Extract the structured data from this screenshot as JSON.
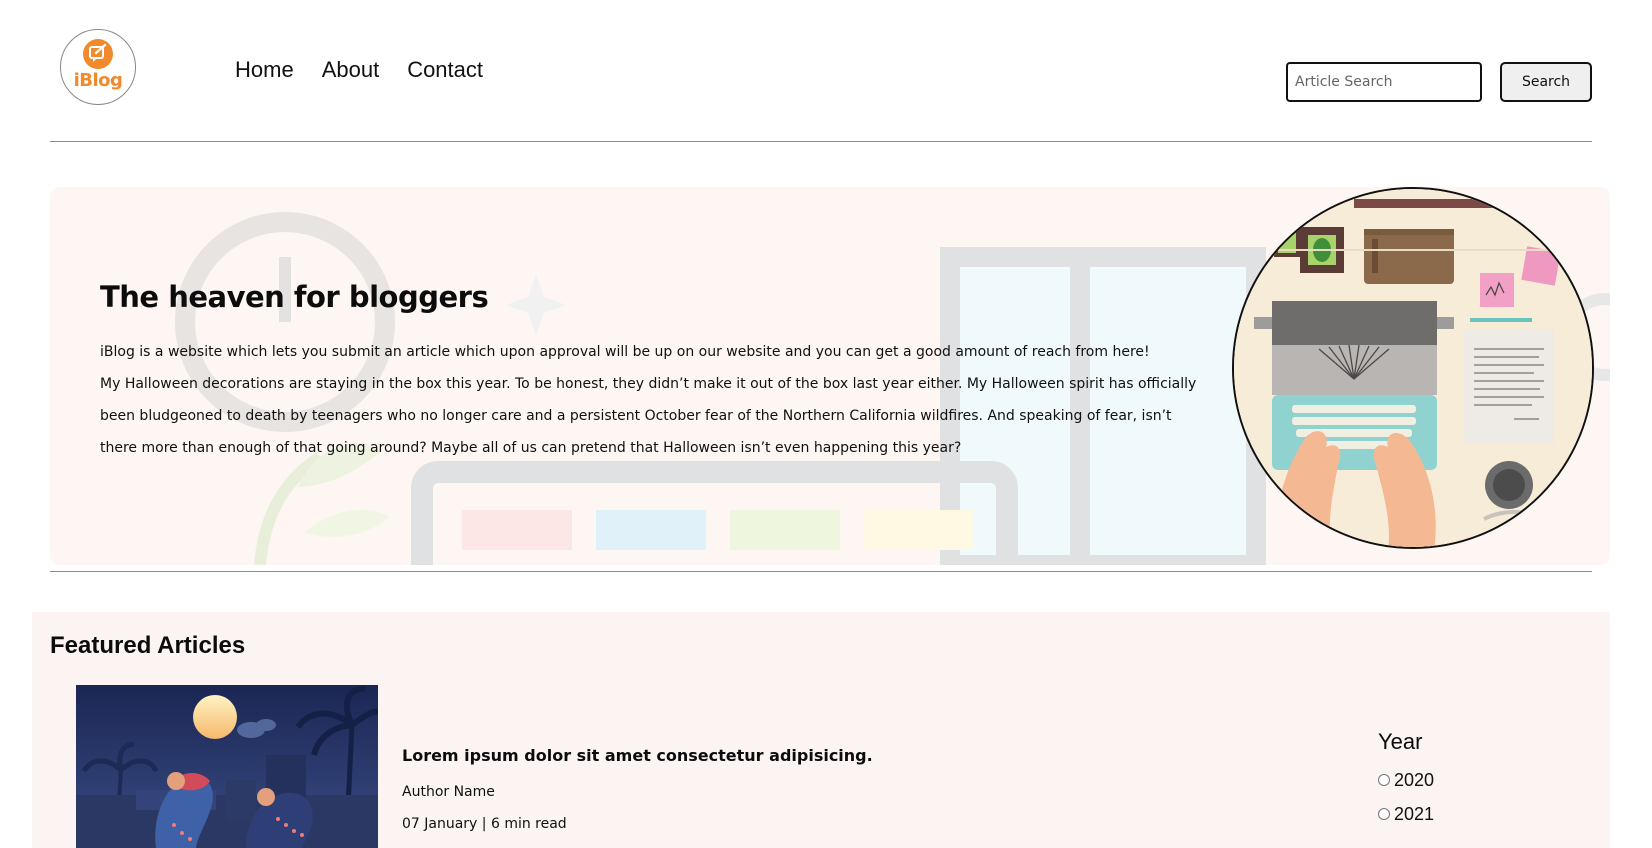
{
  "header": {
    "logo_text": "iBlog",
    "nav": [
      {
        "label": "Home"
      },
      {
        "label": "About"
      },
      {
        "label": "Contact"
      }
    ],
    "search": {
      "placeholder": "Article Search",
      "value": "",
      "button_label": "Search"
    }
  },
  "hero": {
    "title": "The heaven for bloggers",
    "paragraphs": [
      "iBlog is a website which lets you submit an article which upon approval will be up on our website and you can get a good amount of reach from here!",
      "My Halloween decorations are staying in the box this year. To be honest, they didn’t make it out of the box last year either. My Halloween spirit has officially been bludgeoned to death by teenagers who no longer care and a persistent October fear of the Northern California wildfires. And speaking of fear, isn’t there more than enough of that going around? Maybe all of us can pretend that Halloween isn’t even happening this year?"
    ]
  },
  "featured": {
    "title": "Featured Articles",
    "articles": [
      {
        "title": "Lorem ipsum dolor sit amet consectetur adipisicing.",
        "author": "Author Name",
        "meta": "07 January | 6 min read"
      }
    ],
    "filter": {
      "title": "Year",
      "options": [
        {
          "label": "2020",
          "checked": false
        },
        {
          "label": "2021",
          "checked": false
        }
      ]
    }
  },
  "colors": {
    "brand": "#f08a2c",
    "hero_bg": "#fdf6f2",
    "featured_bg": "#fbf4f3"
  }
}
